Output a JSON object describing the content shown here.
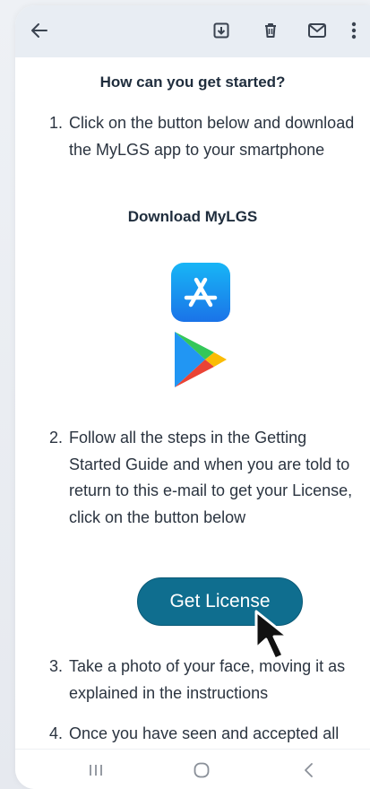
{
  "toolbar": {
    "icons": [
      "back-arrow-icon",
      "archive-icon",
      "delete-icon",
      "mail-icon",
      "more-vert-icon"
    ]
  },
  "email": {
    "heading": "How can you get started?",
    "steps": [
      {
        "number": "1.",
        "text": "Click on the button below and download the MyLGS app to your smartphone"
      },
      {
        "number": "2.",
        "text": "Follow all the steps in the Getting Started Guide and when you are told to return to this e-mail to get your License, click on the button below"
      },
      {
        "number": "3.",
        "text": "Take a photo of your face, moving it as explained in the instructions"
      },
      {
        "number": "4.",
        "text": "Once you have seen and accepted all the documentation"
      }
    ],
    "download_title": "Download MyLGS",
    "license_button": "Get License"
  },
  "navbar": {
    "icons": [
      "recents-icon",
      "home-icon",
      "back-icon"
    ]
  },
  "colors": {
    "accent": "#0f6e8f",
    "toolbar_bg": "#e8edf3",
    "text": "#2b3440"
  }
}
